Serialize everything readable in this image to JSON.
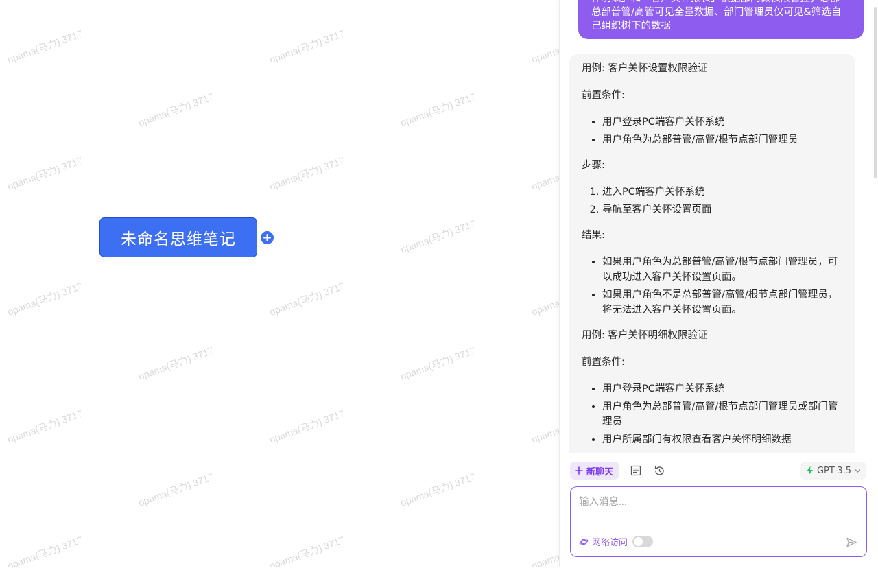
{
  "watermark": "opama(马力) 3717",
  "mindmap": {
    "root_label": "未命名思维笔记",
    "add_icon": "plus-circle-icon"
  },
  "chat": {
    "user_message_lines": [
      "怀明细」和「客户关怀报表」根据部门做权限管控，总部",
      "总部普管/高管可见全量数据、部门管理员仅可见&筛选自",
      "己组织树下的数据"
    ],
    "answer": {
      "case1_title": "用例: 客户关怀设置权限验证",
      "case1_pre_label": "前置条件:",
      "case1_pre": [
        "用户登录PC端客户关怀系统",
        "用户角色为总部普管/高管/根节点部门管理员"
      ],
      "case1_steps_label": "步骤:",
      "case1_steps": [
        "进入PC端客户关怀系统",
        "导航至客户关怀设置页面"
      ],
      "case1_result_label": "结果:",
      "case1_results": [
        "如果用户角色为总部普管/高管/根节点部门管理员，可以成功进入客户关怀设置页面。",
        "如果用户角色不是总部普管/高管/根节点部门管理员，将无法进入客户关怀设置页面。"
      ],
      "case2_title": "用例: 客户关怀明细权限验证",
      "case2_pre_label": "前置条件:",
      "case2_pre": [
        "用户登录PC端客户关怀系统",
        "用户角色为总部普管/高管/根节点部门管理员或部门管理员",
        "用户所属部门有权限查看客户关怀明细数据"
      ]
    },
    "toolbar": {
      "new_chat_label": "新聊天",
      "new_chat_icon": "plus-icon",
      "notes_icon": "document-list-icon",
      "history_icon": "history-clock-icon",
      "model_label": "GPT-3.5",
      "model_icon": "lightning-icon"
    },
    "input": {
      "placeholder": "输入消息...",
      "value": "",
      "web_access_label": "网络访问",
      "web_access_enabled": false,
      "send_icon": "send-icon"
    }
  },
  "colors": {
    "accent": "#8b5cf6",
    "user_bubble": "#8f5cf0",
    "root_node": "#3d6ff2",
    "model_icon": "#22c55e"
  }
}
